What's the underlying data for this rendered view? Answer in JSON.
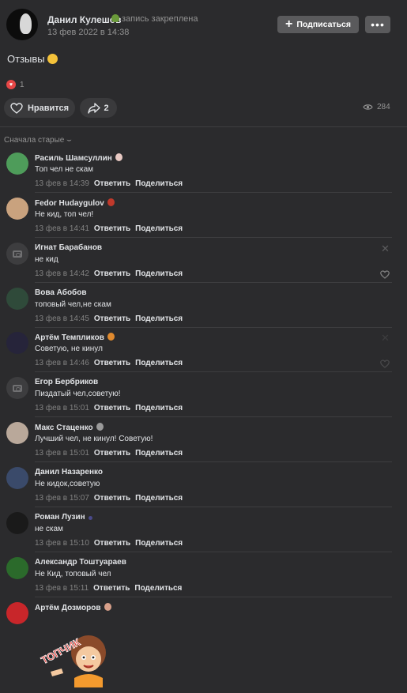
{
  "post": {
    "author": "Данил Кулешов",
    "pin_note": "запись закреплена",
    "date": "13 фев 2022 в 14:38",
    "subscribe_label": "Подписаться",
    "more_label": "•••",
    "text": "Отзывы",
    "reaction_count": "1",
    "like_label": "Нравится",
    "share_count": "2",
    "views": "284"
  },
  "sort_label": "Сначала старые",
  "actions": {
    "reply": "Ответить",
    "share": "Поделиться"
  },
  "sticker_text": "ТОПЧИК",
  "comments": [
    {
      "name": "Расиль Шамсуллин",
      "text": "Топ чел не скам",
      "time": "13 фев в 14:39",
      "avatar_color": "#4e9c5a",
      "badge_color": "#e8c9c3"
    },
    {
      "name": "Fedor Hudaygulov",
      "text": "Не кид, топ чел!",
      "time": "13 фев в 14:41",
      "avatar_color": "#c9a27e",
      "badge_color": "#c0392b"
    },
    {
      "name": "Игнат Барабанов",
      "text": "не кид",
      "time": "13 фев в 14:42",
      "avatar_color": "#3d3d3f",
      "badge_color": ""
    },
    {
      "name": "Вова Абобов",
      "text": "топовый чел,не скам",
      "time": "13 фев в 14:45",
      "avatar_color": "#2f4a3a",
      "badge_color": ""
    },
    {
      "name": "Артём Темпликов",
      "text": "Советую, не кинул",
      "time": "13 фев в 14:46",
      "avatar_color": "#26243a",
      "badge_color": "#e08a2e"
    },
    {
      "name": "Егор Бербриков",
      "text": "Пиздатый чел,советую!",
      "time": "13 фев в 15:01",
      "avatar_color": "#3d3d3f",
      "badge_color": ""
    },
    {
      "name": "Макс Стаценко",
      "text": "Лучший чел, не кинул! Советую!",
      "time": "13 фев в 15:01",
      "avatar_color": "#b9a89a",
      "badge_color": "#9a9a9a"
    },
    {
      "name": "Данил Назаренко",
      "text": "Не кидок,советую",
      "time": "13 фев в 15:07",
      "avatar_color": "#3a4a6a",
      "badge_color": ""
    },
    {
      "name": "Роман Лузин",
      "text": "не скам",
      "time": "13 фев в 15:10",
      "avatar_color": "#1a1a1a",
      "badge_color": "#4a4a8a"
    },
    {
      "name": "Александр Тоштуараев",
      "text": "Не Кид, топовый чел",
      "time": "13 фев в 15:11",
      "avatar_color": "#2b6a2b",
      "badge_color": ""
    },
    {
      "name": "Артём Дозморов",
      "text": "",
      "time": "",
      "avatar_color": "#c8262a",
      "badge_color": "#d8a08a"
    }
  ],
  "colors": {
    "background": "#2b2b2d",
    "button": "#5a5a5c",
    "pill": "#3a3a3c",
    "muted": "#939393"
  }
}
